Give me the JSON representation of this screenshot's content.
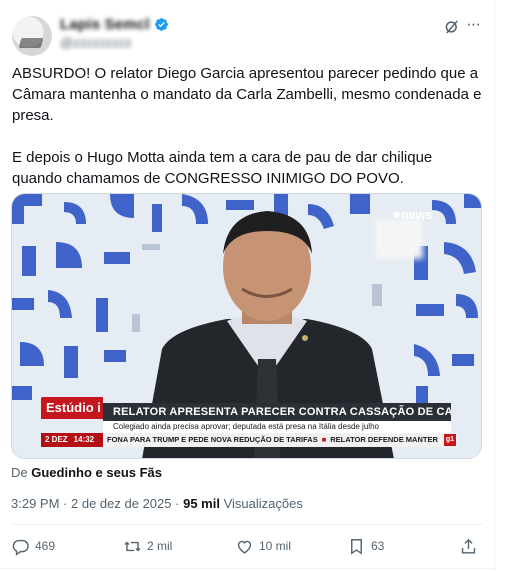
{
  "author": {
    "display_name": "Lapis Semcl",
    "handle": "@zzzzzzzzz"
  },
  "tweet": {
    "paragraph1": "ABSURDO! O relator Diego Garcia apresentou parecer pedindo que a Câmara mantenha o mandato da Carla Zambelli, mesmo condenada e presa.",
    "paragraph2": "E depois o Hugo Motta ainda tem a cara de pau de dar chilique quando chamamos de CONGRESSO INIMIGO DO POVO."
  },
  "media": {
    "channel_logo": "news",
    "program_name": "Estúdio i",
    "date": "2 DEZ",
    "time": "14:32",
    "headline": "RELATOR APRESENTA PARECER CONTRA CASSAÇÃO DE CARLA ZAMBELLI",
    "subline": "Colegiado ainda precisa aprovar; deputada está presa na Itália desde julho",
    "ticker_left": "FONA PARA TRUMP E PEDE NOVA REDUÇÃO DE TARIFAS",
    "ticker_right": "RELATOR DEFENDE MANTER",
    "ticker_badge": "g1"
  },
  "from": {
    "prefix": "De",
    "source": "Guedinho e seus Fãs"
  },
  "meta": {
    "time": "3:29 PM",
    "separator": "·",
    "date": "2 de dez de 2025",
    "views_count": "95 mil",
    "views_label": "Visualizações"
  },
  "actions": {
    "replies": "469",
    "reposts": "2 mil",
    "likes": "10 mil",
    "bookmarks": "63"
  },
  "icons": [
    "verified-badge-icon",
    "grok-icon",
    "more-icon",
    "reply-icon",
    "repost-icon",
    "like-icon",
    "bookmark-icon",
    "share-icon"
  ],
  "colors": {
    "accent": "#1d9bf0",
    "text": "#0f1419",
    "muted": "#536471",
    "news_red": "#c4161c"
  }
}
